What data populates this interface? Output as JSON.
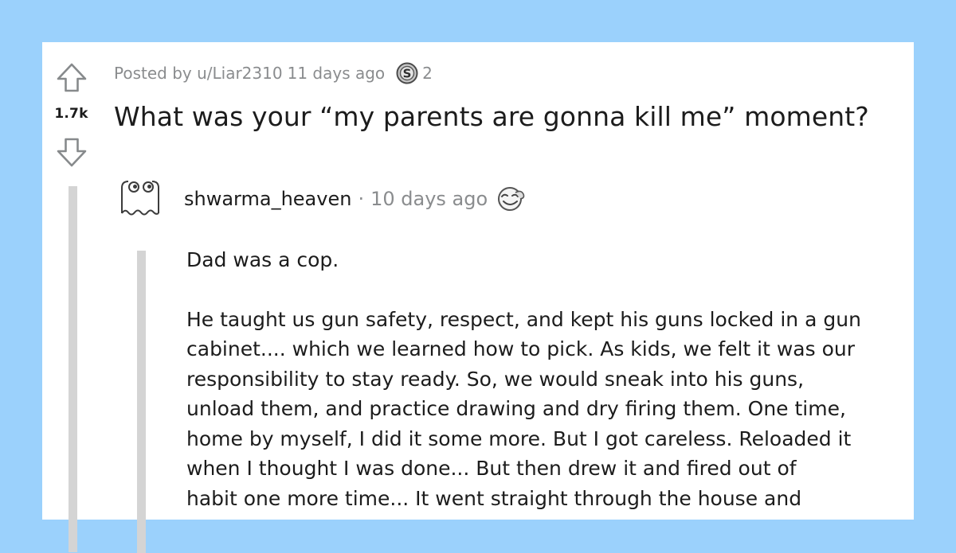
{
  "post": {
    "posted_by": "Posted by u/Liar2310",
    "time_ago": "11 days ago",
    "award_count": "2",
    "award_icon": "silver-award-icon",
    "score": "1.7k",
    "title": "What was your “my parents are gonna kill me” moment?"
  },
  "comment": {
    "author": "shwarma_heaven",
    "separator": "·",
    "time_ago": "10 days ago",
    "award_icon": "wholesome-award-icon",
    "avatar_icon": "ghost-avatar-icon",
    "body_lines": [
      "Dad was a cop.",
      "He taught us gun safety, respect, and kept his guns locked in a gun",
      "cabinet.... which we learned how to pick. As kids, we felt it was our",
      "responsibility to stay ready. So, we would sneak into his guns,",
      "unload them, and practice drawing and dry firing them. One time,",
      "home by myself, I did it some more. But I got careless. Reloaded it",
      "when I thought I was done... But then drew it and fired out of",
      "habit one more time... It went straight through the house and"
    ]
  },
  "colors": {
    "background": "#9bd1fc",
    "card": "#ffffff",
    "text": "#1c1c1c",
    "meta": "#8a8c8e",
    "thread_line": "#d4d4d4"
  }
}
